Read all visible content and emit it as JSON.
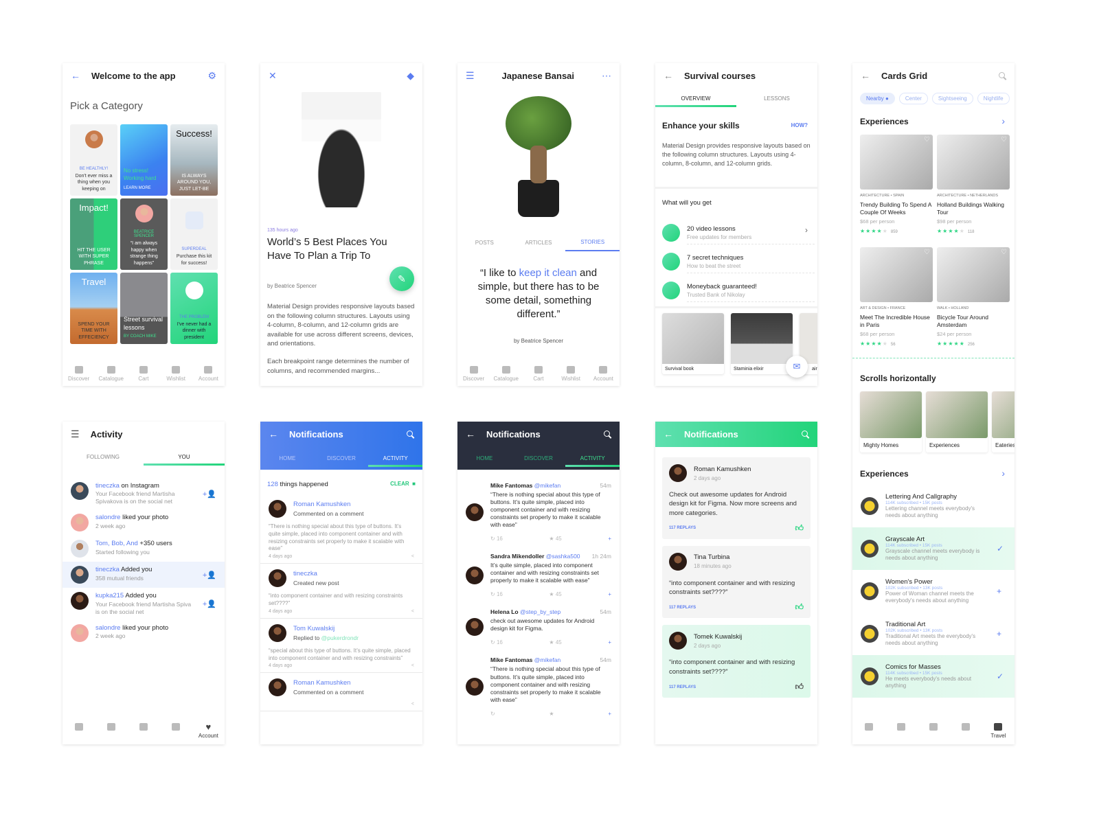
{
  "colors": {
    "accent_blue": "#5b7cf0",
    "accent_green": "#22d47a",
    "dark_header": "#2a2f3e"
  },
  "p1": {
    "title": "Welcome to the app",
    "heading": "Pick a Category",
    "tiles": [
      {
        "head": "",
        "label": "BE HEALTHLY!",
        "text": "Don't ever miss a thing when you keeping on"
      },
      {
        "head": "",
        "label": "LEARN MORE",
        "text": "No stress! Working hard"
      },
      {
        "head": "Success!",
        "label": "",
        "text": "IS ALWAYS AROUND YOU, JUST LET-BE"
      },
      {
        "head": "Impact!",
        "label": "",
        "text": "HIT THE USER WITH SUPER PHRASE"
      },
      {
        "head": "",
        "label": "BEATRICE SPENCER",
        "text": "“I am always happy when strange thing happens”"
      },
      {
        "head": "",
        "label": "SUPERDEAL",
        "text": "Purchase this kit for success!"
      },
      {
        "head": "Travel",
        "label": "",
        "text": "SPEND YOUR TIME WITH EFFECIENCY"
      },
      {
        "head": "",
        "label": "BY COACH MIKE",
        "text": "Street survival lessons"
      },
      {
        "head": "",
        "label": "THE PROBLEM",
        "text": "I've never had a dinner with president"
      }
    ],
    "nav": [
      "Discover",
      "Catalogue",
      "Cart",
      "Wishlist",
      "Account"
    ]
  },
  "p2": {
    "time": "135 hours ago",
    "title": "World’s 5 Best Places You Have To Plan a Trip To",
    "author": "by Beatrice Spencer",
    "para1": "Material Design provides responsive layouts based on the following column structures. Layouts using 4-column, 8-column, and 12-column grids are available for use across different screens, devices, and orientations.",
    "para2": "Each breakpoint range determines the number of columns, and recommended margins..."
  },
  "p3": {
    "title": "Japanese Bansai",
    "tabs": [
      "POSTS",
      "ARTICLES",
      "STORIES"
    ],
    "quote_a": "“I like to ",
    "quote_hl": "keep it clean",
    "quote_b": " and simple, but there has to be some detail, something different.”",
    "author": "by Beatrice Spencer",
    "nav": [
      "Discover",
      "Catalogue",
      "Cart",
      "Wishlist",
      "Account"
    ]
  },
  "p4": {
    "title": "Survival courses",
    "tabs": [
      "OVERVIEW",
      "LESSONS"
    ],
    "heading": "Enhance your skills",
    "how": "HOW?",
    "para": "Material Design provides responsive layouts based on the following column structures. Layouts using 4-column, 8-column, and 12-column grids.",
    "get": "What will you get",
    "items": [
      {
        "t": "20 video lessons",
        "s": "Free updates for members"
      },
      {
        "t": "7 secret techniques",
        "s": "How to beat the street"
      },
      {
        "t": "Moneyback guaranteed!",
        "s": "Trusted Bank of Nikolay"
      }
    ],
    "cards": [
      "Survival book",
      "Staminia elixir",
      "air c"
    ]
  },
  "p5": {
    "title": "Cards Grid",
    "chips": [
      "Nearby",
      "Center",
      "Sightseeing",
      "Nightlife"
    ],
    "exp": "Experiences",
    "cards": [
      {
        "cat": "ARCHITECTURE • SPAIN",
        "t": "Trendy Building To Spend A Couple Of Weeks",
        "p": "$68 per person",
        "rating": 4,
        "n": "859"
      },
      {
        "cat": "ARCHITECTURE • NETHERLANDS",
        "t": "Holland Buildings Walking Tour",
        "p": "$98 per person",
        "rating": 4,
        "n": "118"
      },
      {
        "cat": "ART & DESIGN • FRANCE",
        "t": "Meet The Incredible House in Paris",
        "p": "$68 per person",
        "rating": 4,
        "n": "56"
      },
      {
        "cat": "WALK • HOLLAND",
        "t": "Bicycle Tour Around Amsterdam",
        "p": "$24 per person",
        "rating": 5,
        "n": "256"
      }
    ],
    "scroll": "Scrolls horizontally",
    "hcards": [
      "Mighty Homes",
      "Experiences",
      "Eateries"
    ],
    "exp2": "Experiences",
    "list": [
      {
        "t": "Lettering And Callgraphy",
        "m": "114K subscribed • 15K posts",
        "d": "Lettering channel meets everybody's needs about anything",
        "a": ""
      },
      {
        "t": "Grayscale Art",
        "m": "114K subscribed • 15K posts",
        "d": "Grayscale channel meets everybody is needs about anything",
        "a": "✓"
      },
      {
        "t": "Women's Power",
        "m": "102K subscribed • 13K posts",
        "d": "Power of Woman channel meets the everybody's needs about anything",
        "a": "+"
      },
      {
        "t": "Traditional Art",
        "m": "102K subscribed • 13K posts",
        "d": "Traditional Art meets the everybody's needs about anything",
        "a": "+"
      },
      {
        "t": "Comics for Masses",
        "m": "114K subscribed • 15K posts",
        "d": "He meets everybody's needs about anything",
        "a": "✓"
      }
    ],
    "nav_label": "Travel"
  },
  "p6": {
    "title": "Activity",
    "tabs": [
      "FOLLOWING",
      "YOU"
    ],
    "items": [
      {
        "u": "tineczka",
        "a": " on Instagram",
        "s": "Your Facebook friend Martisha Spivakova is on the social net",
        "add": "+👤"
      },
      {
        "u": "salondre",
        "a": " liked your photo",
        "s": "2 week ago",
        "add": ""
      },
      {
        "u": "Tom, Bob, And",
        "a": " +350 users",
        "s": "Started following you",
        "add": ""
      },
      {
        "u": "tineczka",
        "a": " Added you",
        "s": "358 mutual friends",
        "add": "+👤"
      },
      {
        "u": "kupka215",
        "a": " Added you",
        "s": "Your Facebook friend Martisha Spiva is on the social net",
        "add": "+👤"
      },
      {
        "u": "salondre",
        "a": " liked your photo",
        "s": "2 week ago",
        "add": ""
      }
    ],
    "nav_label": "Account"
  },
  "p7": {
    "title": "Notifications",
    "tabs": [
      "HOME",
      "DISCOVER",
      "ACTIVITY"
    ],
    "count": "128",
    "count_text": " things happened",
    "clear": "CLEAR",
    "items": [
      {
        "n": "Roman Kamushken",
        "a": "Commented on a comment",
        "m": "",
        "q": "“There is nothing special about this type of buttons. It’s quite simple, placed into component container and with resizing constraints set properly to make it scalable with ease”",
        "t": "4 days ago"
      },
      {
        "n": "tineczka",
        "a": "Created new post",
        "m": "",
        "q": "“into component container and with resizing constraints set????”",
        "t": "4 days ago"
      },
      {
        "n": "Tom Kuwalskij",
        "a": "Replied to ",
        "m": "@pukerdrondr",
        "q": "“special about this type of buttons. It’s quite simple, placed into component container and with resizing constraints”",
        "t": "4 days ago"
      },
      {
        "n": "Roman Kamushken",
        "a": "Commented on a comment",
        "m": "",
        "q": "",
        "t": ""
      }
    ]
  },
  "p8": {
    "title": "Notifications",
    "tabs": [
      "HOME",
      "DISCOVER",
      "ACTIVITY"
    ],
    "items": [
      {
        "n": "Mike Fantomas",
        "h": "@mikefan",
        "time": "54m",
        "b": "“There is nothing special about this type of buttons. It’s quite simple, placed into component container and with resizing constraints set properly to make it scalable with ease”",
        "r": "16",
        "s": "45"
      },
      {
        "n": "Sandra Mikendoller",
        "h": "@sashka500",
        "time": "1h 24m",
        "b": "It’s quite simple, placed into component container and with resizing constraints set properly to make it scalable with ease”",
        "r": "16",
        "s": "45"
      },
      {
        "n": "Helena Lo",
        "h": "@step_by_step",
        "time": "54m",
        "b": "check out awesome updates for Android design kit for Figma.",
        "r": "16",
        "s": "45"
      },
      {
        "n": "Mike Fantomas",
        "h": "@mikefan",
        "time": "54m",
        "b": "“There is nothing special about this type of buttons. It’s quite simple, placed into component container and with resizing constraints set properly to make it scalable with ease”",
        "r": "",
        "s": ""
      }
    ]
  },
  "p9": {
    "title": "Notifications",
    "items": [
      {
        "n": "Roman Kamushken",
        "t": "2 days ago",
        "b": "Check out awesome updates for Android design kit for Figma. Now more screens and more categories.",
        "r": "117 REPLAYS"
      },
      {
        "n": "Tina Turbina",
        "t": "18 minutes ago",
        "b": "“into component container and with resizing constraints set????”",
        "r": "117 REPLAYS"
      },
      {
        "n": "Tomek Kuwalskij",
        "t": "2 days ago",
        "b": "“into component container and with resizing constraints set????”",
        "r": "117 REPLAYS"
      }
    ]
  }
}
